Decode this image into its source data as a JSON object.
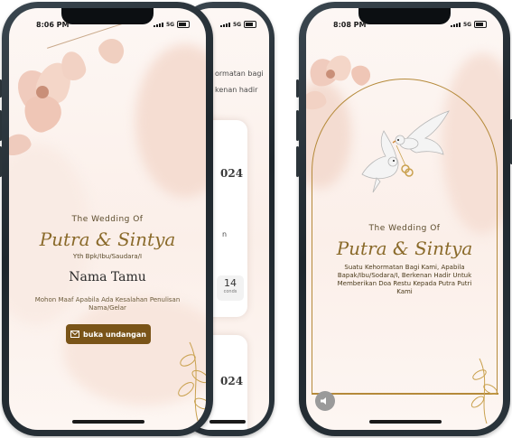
{
  "colors": {
    "gold": "#8a6a2a",
    "brown_button": "#7a5418",
    "blush": "#f3d9cc",
    "text_dark": "#2a2a2a"
  },
  "phone1": {
    "time": "8:06 PM",
    "network": "5G",
    "heading": "The Wedding Of",
    "couple": "Putra & Sintya",
    "recipient_prefix": "Yth Bpk/Ibu/Saudara/I",
    "guest_name": "Nama Tamu",
    "apology": "Mohon Maaf Apabila Ada Kesalahan Penulisan Nama/Gelar",
    "open_button": "buka undangan",
    "open_icon": "envelope-icon"
  },
  "phone2": {
    "network": "5G",
    "partial_line1": "ormatan bagi",
    "partial_line2": "kenan hadir",
    "card1_year": "024",
    "card1_letter": "n",
    "countdown_value": "14",
    "countdown_unit": "conds",
    "card2_year": "024"
  },
  "phone3": {
    "time": "8:08 PM",
    "network": "5G",
    "heading": "The Wedding Of",
    "couple": "Putra & Sintya",
    "message": "Suatu Kehormatan Bagi Kami, Apabila Bapak/Ibu/Sodara/I, Berkenan Hadir Untuk Memberikan Doa Restu Kepada Putra Putri Kami",
    "speaker_icon": "speaker-icon",
    "doves_icon": "doves-with-rings-icon"
  }
}
